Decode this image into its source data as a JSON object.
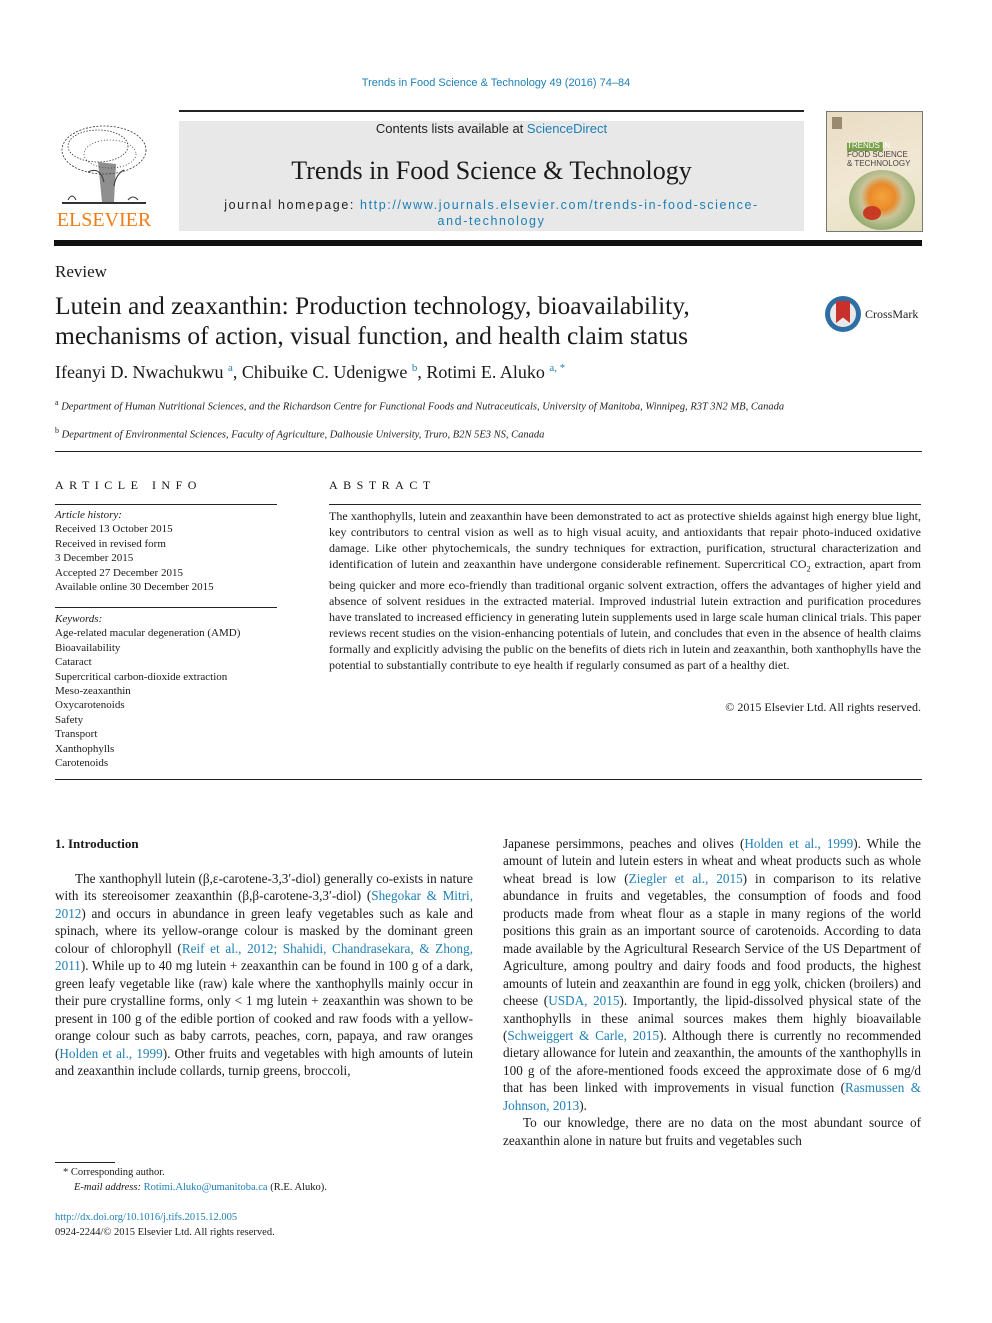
{
  "running_head": "Trends in Food Science & Technology 49 (2016) 74–84",
  "publisher": {
    "logo_word": "ELSEVIER",
    "logo_icon": "elsevier-tree-icon"
  },
  "banner": {
    "contents_prefix": "Contents lists available at ",
    "contents_link": "ScienceDirect",
    "journal_title": "Trends in Food Science & Technology",
    "homepage_label": "journal homepage: ",
    "homepage_url_line1": "http://www.journals.elsevier.com/trends-in-food-science-",
    "homepage_url_line2": "and-technology"
  },
  "cover": {
    "label_line1": "TRENDS IN",
    "label_line2": "FOOD SCIENCE",
    "label_line3": "& TECHNOLOGY"
  },
  "article": {
    "type": "Review",
    "title": "Lutein and zeaxanthin: Production technology, bioavailability, mechanisms of action, visual function, and health claim status",
    "crossmark_label": "CrossMark",
    "authors": [
      {
        "name": "Ifeanyi D. Nwachukwu",
        "sup": "a"
      },
      {
        "name": "Chibuike C. Udenigwe",
        "sup": "b"
      },
      {
        "name": "Rotimi E. Aluko",
        "sup": "a, *"
      }
    ],
    "affiliations": [
      {
        "sup": "a",
        "text": "Department of Human Nutritional Sciences, and the Richardson Centre for Functional Foods and Nutraceuticals, University of Manitoba, Winnipeg, R3T 3N2 MB, Canada"
      },
      {
        "sup": "b",
        "text": "Department of Environmental Sciences, Faculty of Agriculture, Dalhousie University, Truro, B2N 5E3 NS, Canada"
      }
    ]
  },
  "article_info": {
    "heading": "ARTICLE INFO",
    "history_label": "Article history:",
    "history": [
      "Received 13 October 2015",
      "Received in revised form",
      "3 December 2015",
      "Accepted 27 December 2015",
      "Available online 30 December 2015"
    ],
    "keywords_label": "Keywords:",
    "keywords": [
      "Age-related macular degeneration (AMD)",
      "Bioavailability",
      "Cataract",
      "Supercritical carbon-dioxide extraction",
      "Meso-zeaxanthin",
      "Oxycarotenoids",
      "Safety",
      "Transport",
      "Xanthophylls",
      "Carotenoids"
    ]
  },
  "abstract": {
    "heading": "ABSTRACT",
    "text_part1": "The xanthophylls, lutein and zeaxanthin have been demonstrated to act as protective shields against high energy blue light, key contributors to central vision as well as to high visual acuity, and antioxidants that repair photo-induced oxidative damage. Like other phytochemicals, the sundry techniques for extraction, purification, structural characterization and identification of lutein and zeaxanthin have undergone considerable refinement. Supercritical CO",
    "text_sub": "2",
    "text_part2": " extraction, apart from being quicker and more eco-friendly than traditional organic solvent extraction, offers the advantages of higher yield and absence of solvent residues in the extracted material. Improved industrial lutein extraction and purification procedures have translated to increased efficiency in generating lutein supplements used in large scale human clinical trials. This paper reviews recent studies on the vision-enhancing potentials of lutein, and concludes that even in the absence of health claims formally and explicitly advising the public on the benefits of diets rich in lutein and zeaxanthin, both xanthophylls have the potential to substantially contribute to eye health if regularly consumed as part of a healthy diet.",
    "copyright": "© 2015 Elsevier Ltd. All rights reserved."
  },
  "body": {
    "section_heading": "1.  Introduction",
    "left_col": [
      {
        "t": "The xanthophyll lutein (β,ε-carotene-3,3′-diol) generally co-exists in nature with its stereoisomer zeaxanthin (β,β-carotene-3,3′-diol) ("
      },
      {
        "link": "Shegokar & Mitri, 2012"
      },
      {
        "t": ") and occurs in abundance in green leafy vegetables such as kale and spinach, where its yellow-orange colour is masked by the dominant green colour of chlorophyll ("
      },
      {
        "link": "Reif et al., 2012; Shahidi, Chandrasekara, & Zhong, 2011"
      },
      {
        "t": "). While up to 40 mg lutein + zeaxanthin can be found in 100 g of a dark, green leafy vegetable like (raw) kale where the xanthophylls mainly occur in their pure crystalline forms, only < 1 mg lutein + zeaxanthin was shown to be present in 100 g of the edible portion of cooked and raw foods with a yellow-orange colour such as baby carrots, peaches, corn, papaya, and raw oranges ("
      },
      {
        "link": "Holden et al., 1999"
      },
      {
        "t": "). Other fruits and vegetables with high amounts of lutein and zeaxanthin include collards, turnip greens, broccoli,"
      }
    ],
    "right_col_p1": [
      {
        "t": "Japanese persimmons, peaches and olives ("
      },
      {
        "link": "Holden et al., 1999"
      },
      {
        "t": "). While the amount of lutein and lutein esters in wheat and wheat products such as whole wheat bread is low ("
      },
      {
        "link": "Ziegler et al., 2015"
      },
      {
        "t": ") in comparison to its relative abundance in fruits and vegetables, the consumption of foods and food products made from wheat flour as a staple in many regions of the world positions this grain as an important source of carotenoids. According to data made available by the Agricultural Research Service of the US Department of Agriculture, among poultry and dairy foods and food products, the highest amounts of lutein and zeaxanthin are found in egg yolk, chicken (broilers) and cheese ("
      },
      {
        "link": "USDA, 2015"
      },
      {
        "t": "). Importantly, the lipid-dissolved physical state of the xanthophylls in these animal sources makes them highly bioavailable ("
      },
      {
        "link": "Schweiggert & Carle, 2015"
      },
      {
        "t": "). Although there is currently no recommended dietary allowance for lutein and zeaxanthin, the amounts of the xanthophylls in 100 g of the afore-mentioned foods exceed the approximate dose of 6 mg/d that has been linked with improvements in visual function ("
      },
      {
        "link": "Rasmussen & Johnson, 2013"
      },
      {
        "t": ")."
      }
    ],
    "right_col_p2": "To our knowledge, there are no data on the most abundant source of zeaxanthin alone in nature but fruits and vegetables such"
  },
  "footnotes": {
    "corresponding": "*  Corresponding author.",
    "email_label": "E-mail address: ",
    "email": "Rotimi.Aluko@umanitoba.ca",
    "email_suffix": " (R.E. Aluko).",
    "doi": "http://dx.doi.org/10.1016/j.tifs.2015.12.005",
    "issn": "0924-2244/© 2015 Elsevier Ltd. All rights reserved."
  },
  "colors": {
    "link": "#1d7fb4",
    "elsevier_orange": "#f07c14",
    "banner_bg": "#e8e8e8"
  }
}
